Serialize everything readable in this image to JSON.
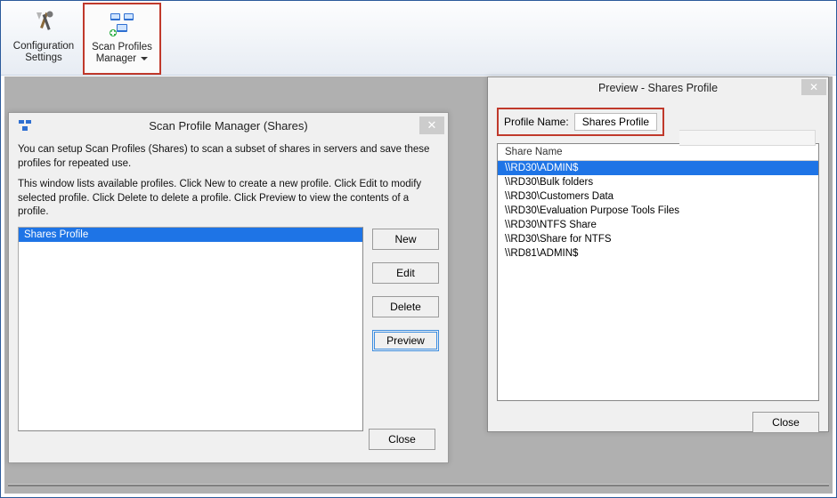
{
  "ribbon": {
    "config": {
      "line1": "Configuration",
      "line2": "Settings"
    },
    "scanProfiles": {
      "line1": "Scan Profiles",
      "line2": "Manager"
    }
  },
  "managerDialog": {
    "title": "Scan Profile Manager (Shares)",
    "intro1": "You can setup Scan Profiles (Shares) to scan a subset of shares in servers and save these profiles for repeated use.",
    "intro2": "This window lists available profiles. Click New to create a new profile. Click Edit to modify selected profile. Click Delete to delete a profile. Click Preview to view the contents of a profile.",
    "profiles": [
      "Shares Profile"
    ],
    "buttons": {
      "new": "New",
      "edit": "Edit",
      "delete": "Delete",
      "preview": "Preview",
      "close": "Close"
    }
  },
  "previewDialog": {
    "title": "Preview - Shares Profile",
    "profileNameLabel": "Profile Name:",
    "profileNameValue": "Shares Profile",
    "columnHeader": "Share Name",
    "shares": [
      "\\\\RD30\\ADMIN$",
      "\\\\RD30\\Bulk folders",
      "\\\\RD30\\Customers Data",
      "\\\\RD30\\Evaluation Purpose Tools  Files",
      "\\\\RD30\\NTFS Share",
      "\\\\RD30\\Share for NTFS",
      "\\\\RD81\\ADMIN$"
    ],
    "closeLabel": "Close"
  }
}
